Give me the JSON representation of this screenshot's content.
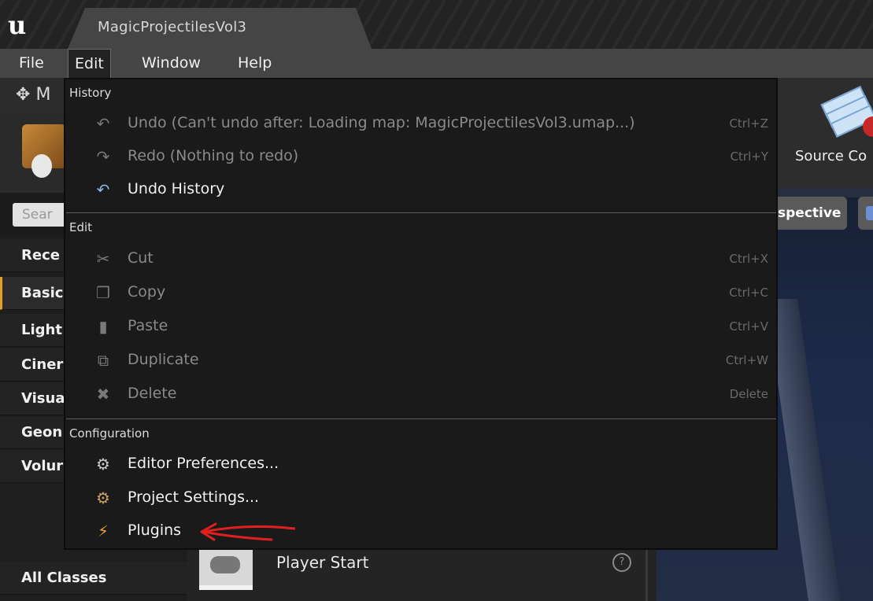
{
  "titlebar": {
    "project_tab": "MagicProjectilesVol3"
  },
  "menubar": {
    "items": [
      "File",
      "Edit",
      "Window",
      "Help"
    ],
    "active": "Edit"
  },
  "modes_panel": {
    "header_partial": "M",
    "search_placeholder": "Sear",
    "categories": [
      "Rece",
      "Basic",
      "Light",
      "Ciner",
      "Visua",
      "Geon",
      "Volur",
      "All Classes"
    ],
    "selected_category": "Basic"
  },
  "content": {
    "player_start_label": "Player Start",
    "help_glyph": "?"
  },
  "toolbar": {
    "source_control_label": "Source Co",
    "perspective_label": "spective"
  },
  "edit_menu": {
    "sections": [
      {
        "title": "History",
        "items": [
          {
            "label": "Undo (Can't undo after: Loading map: MagicProjectilesVol3.umap...)",
            "shortcut": "Ctrl+Z",
            "icon": "undo-icon",
            "enabled": false
          },
          {
            "label": "Redo (Nothing to redo)",
            "shortcut": "Ctrl+Y",
            "icon": "redo-icon",
            "enabled": false
          },
          {
            "label": "Undo History",
            "shortcut": "",
            "icon": "undo-history-icon",
            "enabled": true
          }
        ]
      },
      {
        "title": "Edit",
        "items": [
          {
            "label": "Cut",
            "shortcut": "Ctrl+X",
            "icon": "scissors-icon",
            "enabled": false
          },
          {
            "label": "Copy",
            "shortcut": "Ctrl+C",
            "icon": "copy-icon",
            "enabled": false
          },
          {
            "label": "Paste",
            "shortcut": "Ctrl+V",
            "icon": "paste-icon",
            "enabled": false
          },
          {
            "label": "Duplicate",
            "shortcut": "Ctrl+W",
            "icon": "duplicate-icon",
            "enabled": false
          },
          {
            "label": "Delete",
            "shortcut": "Delete",
            "icon": "delete-icon",
            "enabled": false
          }
        ]
      },
      {
        "title": "Configuration",
        "items": [
          {
            "label": "Editor Preferences...",
            "shortcut": "",
            "icon": "editor-preferences-icon",
            "enabled": true
          },
          {
            "label": "Project Settings...",
            "shortcut": "",
            "icon": "project-settings-icon",
            "enabled": true
          },
          {
            "label": "Plugins",
            "shortcut": "",
            "icon": "plugin-icon",
            "enabled": true
          }
        ]
      }
    ]
  },
  "colors": {
    "menubar_bg": "#454545",
    "menu_bg": "#1a1a1a",
    "selected_category_accent": "#e0a020",
    "annotation_arrow": "#e02020"
  }
}
